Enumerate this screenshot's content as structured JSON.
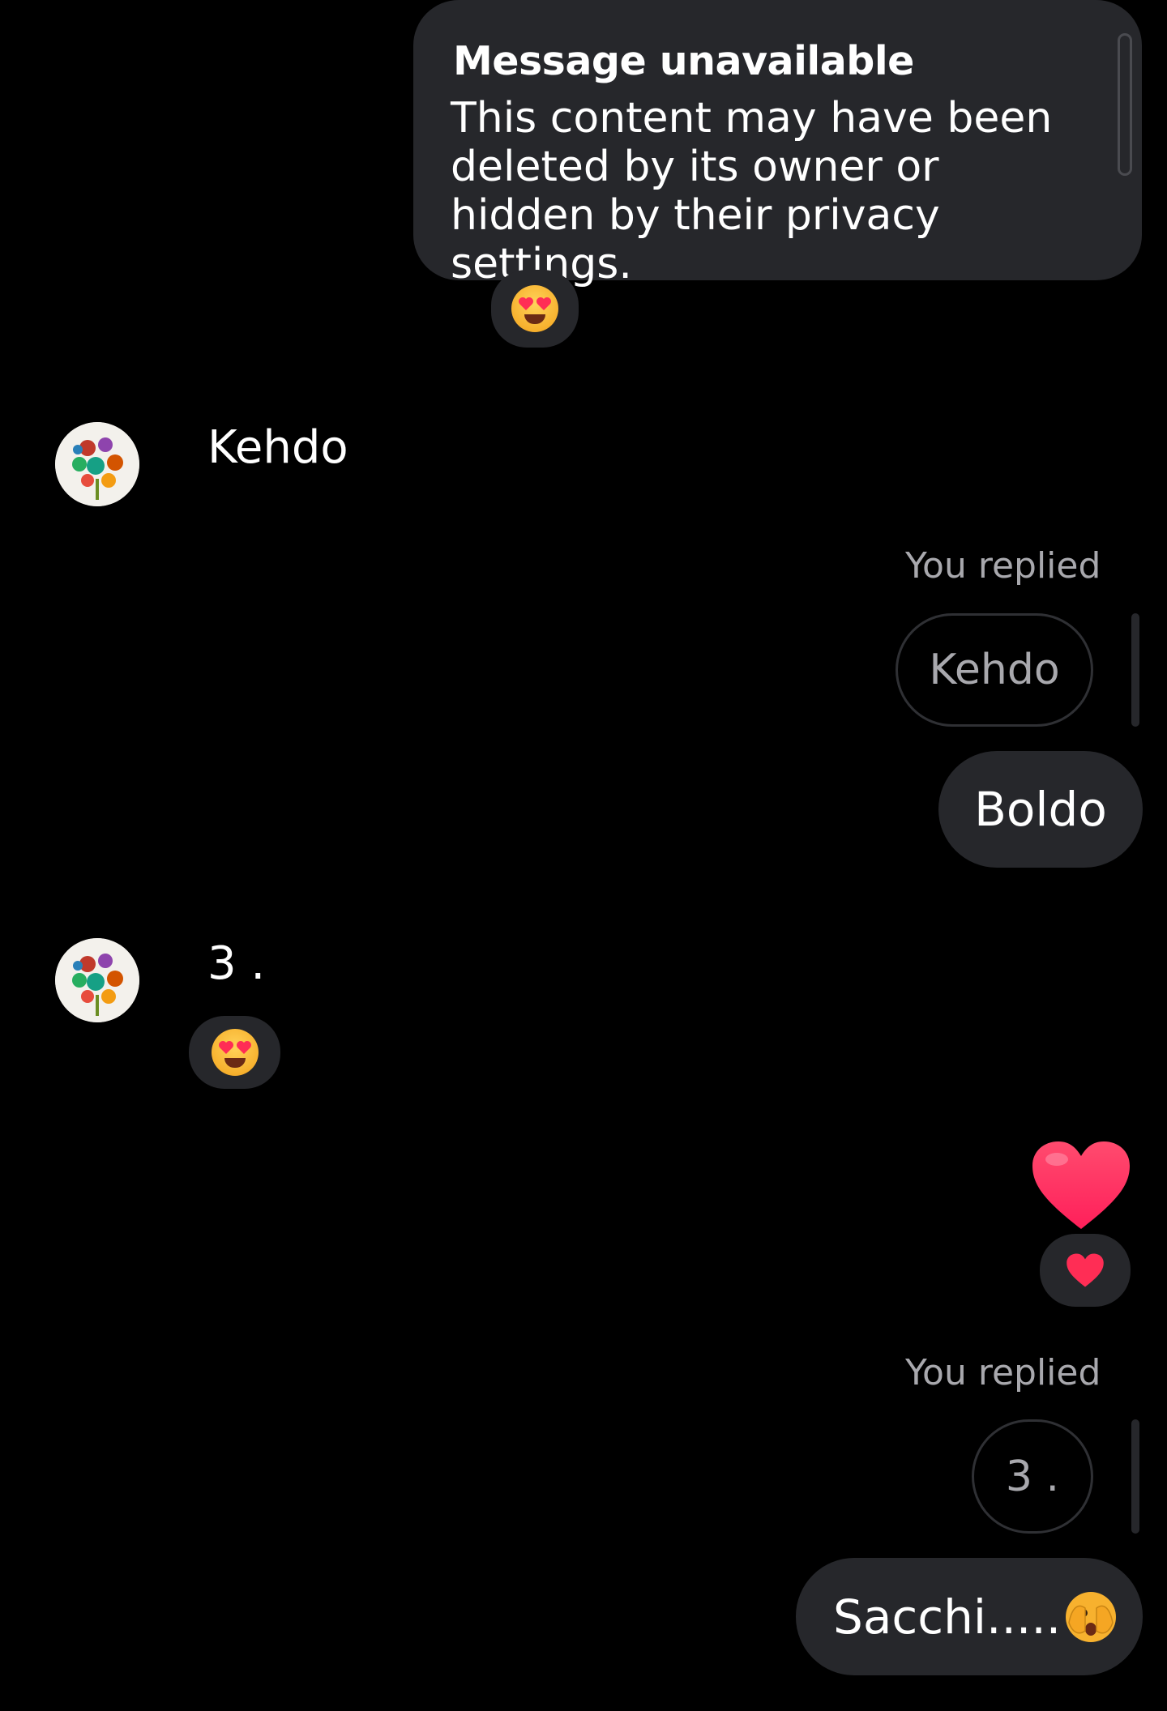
{
  "messages": {
    "unavailable": {
      "title": "Message unavailable",
      "body": "This content may have been deleted by its owner or hidden by their privacy settings."
    },
    "kehdo": {
      "text": "Kehdo"
    },
    "reply1": {
      "label": "You replied",
      "quoted": "Kehdo",
      "text": "Boldo"
    },
    "three": {
      "text": "3 ."
    },
    "reply2": {
      "label": "You replied",
      "quoted": "3 .",
      "text": "Sacchi....."
    }
  },
  "icons": {
    "heart_eyes": "heart-eyes-emoji",
    "heart": "red-heart-emoji",
    "peek": "face-with-peeking-eye-emoji"
  },
  "colors": {
    "background": "#000000",
    "bubble": "#26272b",
    "secondary_text": "#a8a8ad",
    "heart": "#ff2d55"
  }
}
